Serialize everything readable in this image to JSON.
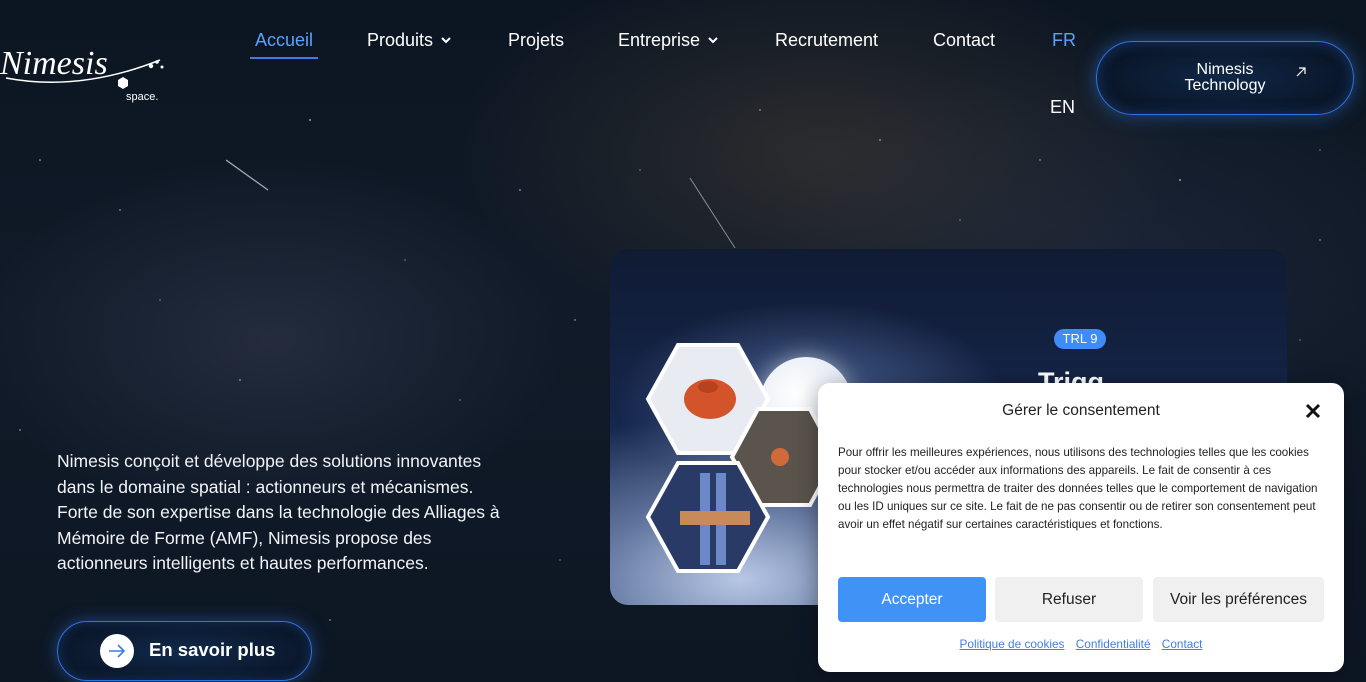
{
  "brand": {
    "logo_text": "Nimesis",
    "logo_sub": "space.",
    "accent": "#3e8cf5"
  },
  "nav": {
    "items": [
      {
        "label": "Accueil",
        "active": true
      },
      {
        "label": "Produits",
        "dropdown": true
      },
      {
        "label": "Projets"
      },
      {
        "label": "Entreprise",
        "dropdown": true
      },
      {
        "label": "Recrutement"
      },
      {
        "label": "Contact"
      }
    ],
    "lang_fr": "FR",
    "lang_en": "EN",
    "tech_button": "Nimesis Technology",
    "tech_button_icon": "arrow-up-right-icon"
  },
  "hero": {
    "text": "Nimesis conçoit et développe des solutions innovantes dans le domaine spatial : actionneurs et mécanismes. Forte de son expertise dans la technologie des Alliages à Mémoire de Forme (AMF), Nimesis propose des actionneurs intelligents et hautes performances.",
    "cta": "En savoir plus",
    "cta_icon": "arrow-right-icon"
  },
  "card": {
    "badge": "TRL 9",
    "title": "Trigg"
  },
  "consent": {
    "title": "Gérer le consentement",
    "body": "Pour offrir les meilleures expériences, nous utilisons des technologies telles que les cookies pour stocker et/ou accéder aux informations des appareils. Le fait de consentir à ces technologies nous permettra de traiter des données telles que le comportement de navigation ou les ID uniques sur ce site. Le fait de ne pas consentir ou de retirer son consentement peut avoir un effet négatif sur certaines caractéristiques et fonctions.",
    "accept": "Accepter",
    "refuse": "Refuser",
    "prefs": "Voir les préférences",
    "links": [
      "Politique de cookies",
      "Confidentialité",
      "Contact"
    ],
    "accept_color": "#3f93f7"
  }
}
